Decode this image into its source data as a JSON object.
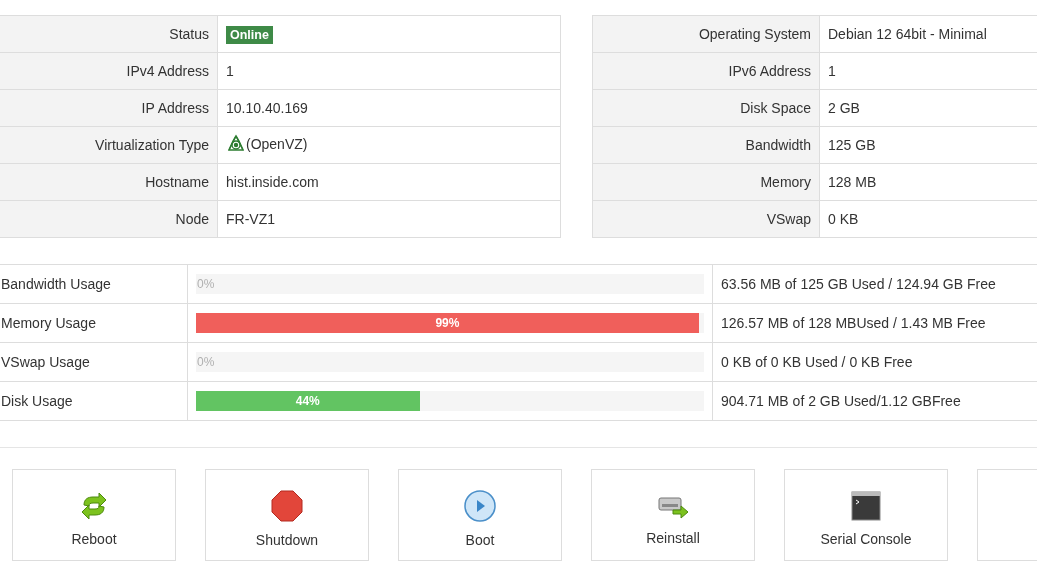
{
  "info_left": [
    {
      "label": "Status",
      "kind": "badge",
      "value": "Online",
      "color": "#3e8a47"
    },
    {
      "label": "IPv4 Address",
      "kind": "text",
      "value": "1"
    },
    {
      "label": "IP Address",
      "kind": "text",
      "value": "10.10.40.169"
    },
    {
      "label": "Virtualization Type",
      "kind": "virt",
      "value": "(OpenVZ)"
    },
    {
      "label": "Hostname",
      "kind": "text",
      "value": "hist.inside.com"
    },
    {
      "label": "Node",
      "kind": "text",
      "value": "FR-VZ1"
    }
  ],
  "info_right": [
    {
      "label": "Operating System",
      "kind": "text",
      "value": "Debian 12 64bit - Minimal"
    },
    {
      "label": "IPv6 Address",
      "kind": "text",
      "value": "1"
    },
    {
      "label": "Disk Space",
      "kind": "text",
      "value": "2 GB"
    },
    {
      "label": "Bandwidth",
      "kind": "text",
      "value": "125 GB"
    },
    {
      "label": "Memory",
      "kind": "text",
      "value": "128 MB"
    },
    {
      "label": "VSwap",
      "kind": "text",
      "value": "0 KB"
    }
  ],
  "usage": [
    {
      "label": "Bandwidth Usage",
      "level": 0,
      "percent": "0%",
      "detail": "63.56 MB of 125 GB Used / 124.94 GB Free"
    },
    {
      "label": "Memory Usage",
      "level": 0.99,
      "percent": "99%",
      "color": "#f05f5b",
      "detail": "126.57 MB of 128 MBUsed / 1.43 MB Free"
    },
    {
      "label": "VSwap Usage",
      "level": 0,
      "percent": "0%",
      "detail": "0 KB of 0 KB Used / 0 KB Free"
    },
    {
      "label": "Disk Usage",
      "level": 0.44,
      "percent": "44%",
      "color": "#62c462",
      "detail": "904.71 MB of 2 GB Used/1.12 GBFree"
    }
  ],
  "actions": [
    {
      "kind": "reboot",
      "label": "Reboot"
    },
    {
      "kind": "shutdown",
      "label": "Shutdown"
    },
    {
      "kind": "boot",
      "label": "Boot"
    },
    {
      "kind": "reinstall",
      "label": "Reinstall"
    },
    {
      "kind": "console",
      "label": "Serial Console"
    },
    {
      "kind": "blank"
    }
  ]
}
